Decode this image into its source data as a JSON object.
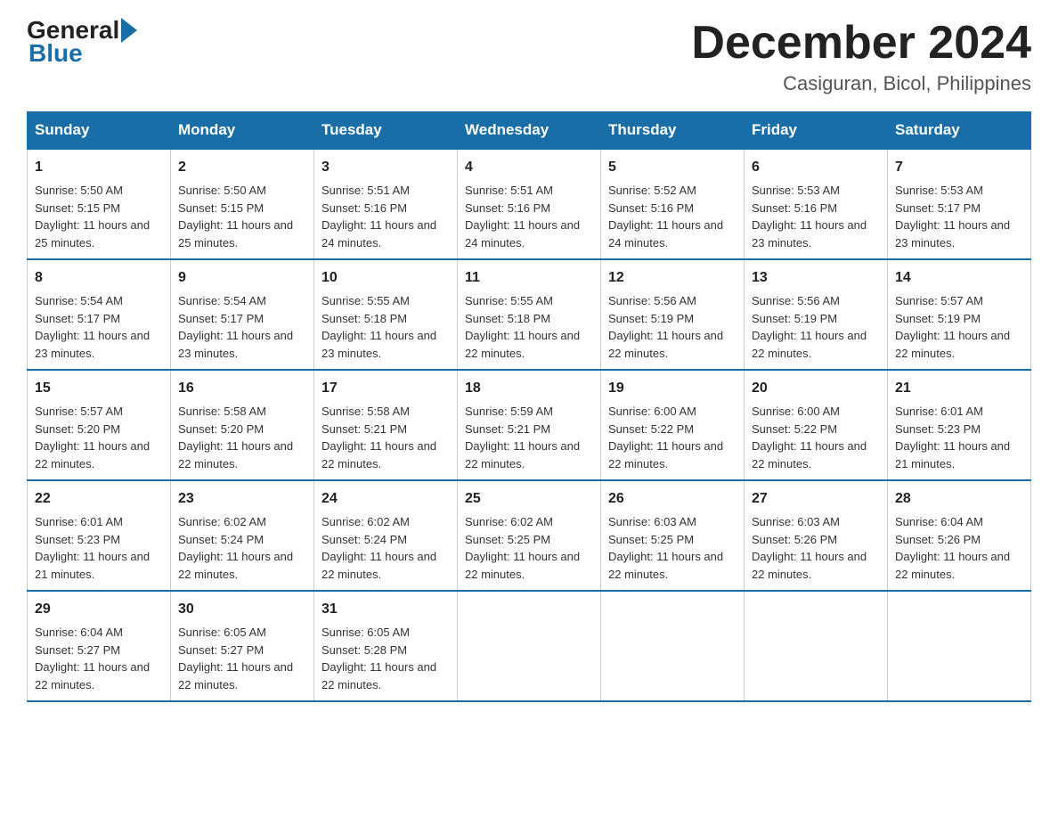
{
  "header": {
    "logo_general": "General",
    "logo_blue": "Blue",
    "month_title": "December 2024",
    "subtitle": "Casiguran, Bicol, Philippines"
  },
  "days_of_week": [
    "Sunday",
    "Monday",
    "Tuesday",
    "Wednesday",
    "Thursday",
    "Friday",
    "Saturday"
  ],
  "weeks": [
    [
      {
        "num": "1",
        "sunrise": "5:50 AM",
        "sunset": "5:15 PM",
        "daylight": "11 hours and 25 minutes."
      },
      {
        "num": "2",
        "sunrise": "5:50 AM",
        "sunset": "5:15 PM",
        "daylight": "11 hours and 25 minutes."
      },
      {
        "num": "3",
        "sunrise": "5:51 AM",
        "sunset": "5:16 PM",
        "daylight": "11 hours and 24 minutes."
      },
      {
        "num": "4",
        "sunrise": "5:51 AM",
        "sunset": "5:16 PM",
        "daylight": "11 hours and 24 minutes."
      },
      {
        "num": "5",
        "sunrise": "5:52 AM",
        "sunset": "5:16 PM",
        "daylight": "11 hours and 24 minutes."
      },
      {
        "num": "6",
        "sunrise": "5:53 AM",
        "sunset": "5:16 PM",
        "daylight": "11 hours and 23 minutes."
      },
      {
        "num": "7",
        "sunrise": "5:53 AM",
        "sunset": "5:17 PM",
        "daylight": "11 hours and 23 minutes."
      }
    ],
    [
      {
        "num": "8",
        "sunrise": "5:54 AM",
        "sunset": "5:17 PM",
        "daylight": "11 hours and 23 minutes."
      },
      {
        "num": "9",
        "sunrise": "5:54 AM",
        "sunset": "5:17 PM",
        "daylight": "11 hours and 23 minutes."
      },
      {
        "num": "10",
        "sunrise": "5:55 AM",
        "sunset": "5:18 PM",
        "daylight": "11 hours and 23 minutes."
      },
      {
        "num": "11",
        "sunrise": "5:55 AM",
        "sunset": "5:18 PM",
        "daylight": "11 hours and 22 minutes."
      },
      {
        "num": "12",
        "sunrise": "5:56 AM",
        "sunset": "5:19 PM",
        "daylight": "11 hours and 22 minutes."
      },
      {
        "num": "13",
        "sunrise": "5:56 AM",
        "sunset": "5:19 PM",
        "daylight": "11 hours and 22 minutes."
      },
      {
        "num": "14",
        "sunrise": "5:57 AM",
        "sunset": "5:19 PM",
        "daylight": "11 hours and 22 minutes."
      }
    ],
    [
      {
        "num": "15",
        "sunrise": "5:57 AM",
        "sunset": "5:20 PM",
        "daylight": "11 hours and 22 minutes."
      },
      {
        "num": "16",
        "sunrise": "5:58 AM",
        "sunset": "5:20 PM",
        "daylight": "11 hours and 22 minutes."
      },
      {
        "num": "17",
        "sunrise": "5:58 AM",
        "sunset": "5:21 PM",
        "daylight": "11 hours and 22 minutes."
      },
      {
        "num": "18",
        "sunrise": "5:59 AM",
        "sunset": "5:21 PM",
        "daylight": "11 hours and 22 minutes."
      },
      {
        "num": "19",
        "sunrise": "6:00 AM",
        "sunset": "5:22 PM",
        "daylight": "11 hours and 22 minutes."
      },
      {
        "num": "20",
        "sunrise": "6:00 AM",
        "sunset": "5:22 PM",
        "daylight": "11 hours and 22 minutes."
      },
      {
        "num": "21",
        "sunrise": "6:01 AM",
        "sunset": "5:23 PM",
        "daylight": "11 hours and 21 minutes."
      }
    ],
    [
      {
        "num": "22",
        "sunrise": "6:01 AM",
        "sunset": "5:23 PM",
        "daylight": "11 hours and 21 minutes."
      },
      {
        "num": "23",
        "sunrise": "6:02 AM",
        "sunset": "5:24 PM",
        "daylight": "11 hours and 22 minutes."
      },
      {
        "num": "24",
        "sunrise": "6:02 AM",
        "sunset": "5:24 PM",
        "daylight": "11 hours and 22 minutes."
      },
      {
        "num": "25",
        "sunrise": "6:02 AM",
        "sunset": "5:25 PM",
        "daylight": "11 hours and 22 minutes."
      },
      {
        "num": "26",
        "sunrise": "6:03 AM",
        "sunset": "5:25 PM",
        "daylight": "11 hours and 22 minutes."
      },
      {
        "num": "27",
        "sunrise": "6:03 AM",
        "sunset": "5:26 PM",
        "daylight": "11 hours and 22 minutes."
      },
      {
        "num": "28",
        "sunrise": "6:04 AM",
        "sunset": "5:26 PM",
        "daylight": "11 hours and 22 minutes."
      }
    ],
    [
      {
        "num": "29",
        "sunrise": "6:04 AM",
        "sunset": "5:27 PM",
        "daylight": "11 hours and 22 minutes."
      },
      {
        "num": "30",
        "sunrise": "6:05 AM",
        "sunset": "5:27 PM",
        "daylight": "11 hours and 22 minutes."
      },
      {
        "num": "31",
        "sunrise": "6:05 AM",
        "sunset": "5:28 PM",
        "daylight": "11 hours and 22 minutes."
      },
      null,
      null,
      null,
      null
    ]
  ]
}
